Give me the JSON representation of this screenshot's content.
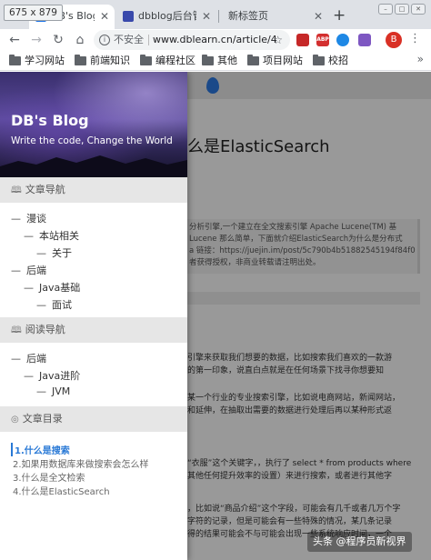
{
  "dimension_badge": "675 x 879",
  "tabs": [
    {
      "title": "DB's Blog-加油!",
      "active": true
    },
    {
      "title": "dbblog后台管",
      "active": false
    },
    {
      "title": "新标签页",
      "active": false
    }
  ],
  "toolbar": {
    "security": "不安全",
    "url": "www.dblearn.cn/article/4",
    "profile_initial": "B",
    "extensions": [
      "ABP"
    ]
  },
  "bookmarks": [
    "学习网站",
    "前端知识",
    "编程社区",
    "其他",
    "项目网站",
    "校招"
  ],
  "blog": {
    "title": "DB's Blog",
    "subtitle": "Write the code, Change the World"
  },
  "sidebar": {
    "article_nav": {
      "heading": "文章导航",
      "items": [
        {
          "label": "漫谈",
          "level": 1
        },
        {
          "label": "本站相关",
          "level": 2
        },
        {
          "label": "关于",
          "level": 3
        },
        {
          "label": "后端",
          "level": 1
        },
        {
          "label": "Java基础",
          "level": 2
        },
        {
          "label": "面试",
          "level": 3
        }
      ]
    },
    "reading_nav": {
      "heading": "阅读导航",
      "items": [
        {
          "label": "后端",
          "level": 1
        },
        {
          "label": "Java进阶",
          "level": 2
        },
        {
          "label": "JVM",
          "level": 3
        }
      ]
    },
    "toc": {
      "heading": "文章目录",
      "items": [
        "1.什么是搜索",
        "2.如果用数据库来做搜索会怎么样",
        "3.什么是全文检索",
        "4.什么是ElasticSearch"
      ]
    }
  },
  "article": {
    "title_fragment": "么是ElasticSearch",
    "quote_lines": [
      "分析引擎,一个建立在全文搜索引擎 Apache Lucene(TM) 基",
      "Lucene 那么简单，下面就介绍ElasticSearch为什么是分布式",
      "a 链接：https://juejin.im/post/5c790b4b51882545194f84f0 来",
      "者获得授权，非商业转载请注明出处。"
    ],
    "para1": [
      "引擎来获取我们想要的数据，比如搜索我们喜欢的一款游",
      "的第一印象，说直白点就是在任何场景下找寻你想要知"
    ],
    "para2": [
      "某一个行业的专业搜索引擎，比如说电商网站，新闻网站，",
      "和延伸，在抽取出需要的数据进行处理后再以某种形式返"
    ],
    "para3": [
      "“衣服”这个关键字，，执行了 select * from products where",
      "其他任何提升效率的设置）来进行搜索，或者进行其他字"
    ],
    "para4": [
      "，比如说“商品介绍”这个字段，可能会有几千或者几万个字",
      "字符的记录，但是可能会有一些特殊的情况，某几条记录",
      "得的结果可能会不与可能会出现一些系统响应时间，一个"
    ]
  },
  "watermark": "头条 @程序员新视界"
}
